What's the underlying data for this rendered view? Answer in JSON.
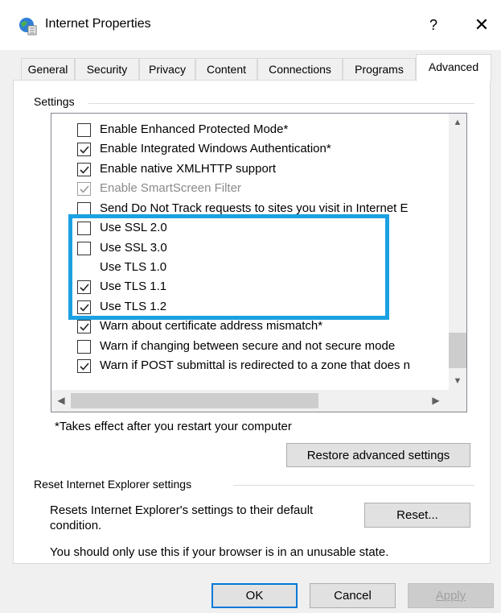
{
  "window": {
    "title": "Internet Properties",
    "help_label": "?",
    "close_label": "✕",
    "icon": "internet-options-globe-icon"
  },
  "tabs": [
    {
      "label": "General",
      "active": false
    },
    {
      "label": "Security",
      "active": false
    },
    {
      "label": "Privacy",
      "active": false
    },
    {
      "label": "Content",
      "active": false
    },
    {
      "label": "Connections",
      "active": false
    },
    {
      "label": "Programs",
      "active": false
    },
    {
      "label": "Advanced",
      "active": true
    }
  ],
  "settings": {
    "group_label": "Settings",
    "items": [
      {
        "label": "Enable Enhanced Protected Mode*",
        "checked": false,
        "has_checkbox": true,
        "disabled": false
      },
      {
        "label": "Enable Integrated Windows Authentication*",
        "checked": true,
        "has_checkbox": true,
        "disabled": false
      },
      {
        "label": "Enable native XMLHTTP support",
        "checked": true,
        "has_checkbox": true,
        "disabled": false
      },
      {
        "label": "Enable SmartScreen Filter",
        "checked": true,
        "has_checkbox": true,
        "disabled": true
      },
      {
        "label": "Send Do Not Track requests to sites you visit in Internet E",
        "checked": false,
        "has_checkbox": true,
        "disabled": false
      },
      {
        "label": "Use SSL 2.0",
        "checked": false,
        "has_checkbox": true,
        "disabled": false
      },
      {
        "label": "Use SSL 3.0",
        "checked": false,
        "has_checkbox": true,
        "disabled": false
      },
      {
        "label": "Use TLS 1.0",
        "checked": false,
        "has_checkbox": false,
        "disabled": false
      },
      {
        "label": "Use TLS 1.1",
        "checked": true,
        "has_checkbox": true,
        "disabled": false
      },
      {
        "label": "Use TLS 1.2",
        "checked": true,
        "has_checkbox": true,
        "disabled": false
      },
      {
        "label": "Warn about certificate address mismatch*",
        "checked": true,
        "has_checkbox": true,
        "disabled": false
      },
      {
        "label": "Warn if changing between secure and not secure mode",
        "checked": false,
        "has_checkbox": true,
        "disabled": false
      },
      {
        "label": "Warn if POST submittal is redirected to a zone that does n",
        "checked": true,
        "has_checkbox": true,
        "disabled": false
      }
    ],
    "restart_note": "*Takes effect after you restart your computer",
    "restore_button": "Restore advanced settings"
  },
  "reset": {
    "group_label": "Reset Internet Explorer settings",
    "description": "Resets Internet Explorer's settings to their default condition.",
    "button": "Reset...",
    "warning": "You should only use this if your browser is in an unusable state."
  },
  "footer": {
    "ok": "OK",
    "cancel": "Cancel",
    "apply": "Apply"
  },
  "colors": {
    "highlight_border": "#1ba1e2",
    "default_button_border": "#0078d7"
  }
}
